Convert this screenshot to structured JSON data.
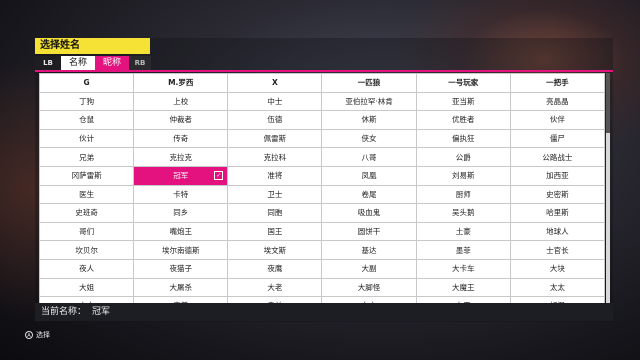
{
  "header": {
    "title": "选择姓名"
  },
  "tabs": {
    "lb": "LB",
    "name": "名称",
    "nickname": "昵称",
    "rb": "RB"
  },
  "grid": {
    "columns": [
      "G",
      "M.罗西",
      "X",
      "一匹狼",
      "一号玩家",
      "一把手"
    ],
    "rows": [
      [
        "丁狗",
        "上校",
        "中士",
        "亚伯拉罕·林肯",
        "亚当斯",
        "亮晶晶"
      ],
      [
        "仓鼠",
        "仲裁者",
        "伍德",
        "休斯",
        "优胜者",
        "伙伴"
      ],
      [
        "伙计",
        "传奇",
        "佩雷斯",
        "侠女",
        "偏执狂",
        "僵尸"
      ],
      [
        "兄弟",
        "克拉克",
        "克拉科",
        "八哥",
        "公爵",
        "公路战士"
      ],
      [
        "冈萨雷斯",
        "冠军",
        "准将",
        "凤凰",
        "刘易斯",
        "加西亚"
      ],
      [
        "医生",
        "卡特",
        "卫士",
        "卷尾",
        "厨师",
        "史密斯"
      ],
      [
        "史班奇",
        "同乡",
        "同胞",
        "吸血鬼",
        "吴头鹅",
        "哈里斯"
      ],
      [
        "哥们",
        "嘴炮王",
        "国王",
        "圆饼干",
        "土豪",
        "地球人"
      ],
      [
        "坎贝尔",
        "埃尔南德斯",
        "埃文斯",
        "基达",
        "墨菲",
        "士官长"
      ],
      [
        "夜人",
        "夜猫子",
        "夜鹰",
        "大副",
        "大卡车",
        "大块"
      ],
      [
        "大姐",
        "大屠杀",
        "大老",
        "大脚怪",
        "大魔王",
        "太太"
      ],
      [
        "夫人",
        "奇普",
        "奥兹",
        "女士",
        "女王",
        "好汉"
      ]
    ]
  },
  "current": {
    "label": "当前名称：",
    "value": "冠军"
  },
  "footer": {
    "button_glyph": "A",
    "select_label": "选择"
  }
}
